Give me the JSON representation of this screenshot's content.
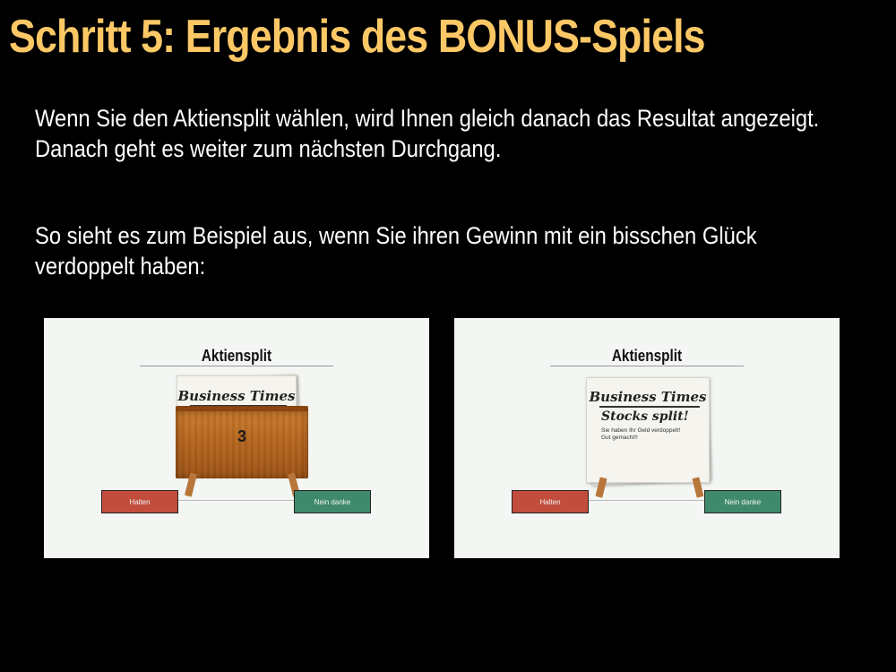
{
  "title": "Schritt 5: Ergebnis des BONUS-Spiels",
  "paragraph1": {
    "line1": "Wenn Sie den Aktiensplit wählen, wird Ihnen gleich danach das Resultat angezeigt.",
    "line2": "Danach geht es weiter zum nächsten Durchgang."
  },
  "paragraph2": {
    "line1": "So sieht es zum Beispiel aus, wenn Sie ihren Gewinn mit ein bisschen Glück",
    "line2": "verdoppelt haben:"
  },
  "screenshots": [
    {
      "title": "Aktiensplit",
      "masthead": "Business Times",
      "crate_number": "3",
      "button_left": "Halten",
      "button_right": "Nein danke"
    },
    {
      "title": "Aktiensplit",
      "masthead": "Business Times",
      "headline": "Stocks split!",
      "message_line1": "Sie haben Ihr Geld verdoppelt!",
      "message_line2": "Gut gemacht!!",
      "button_left": "Halten",
      "button_right": "Nein danke"
    }
  ],
  "colors": {
    "background": "#000000",
    "title": "#fcc866",
    "text": "#ffffff",
    "button_red": "#c24d3d",
    "button_green": "#3f8a6d"
  }
}
